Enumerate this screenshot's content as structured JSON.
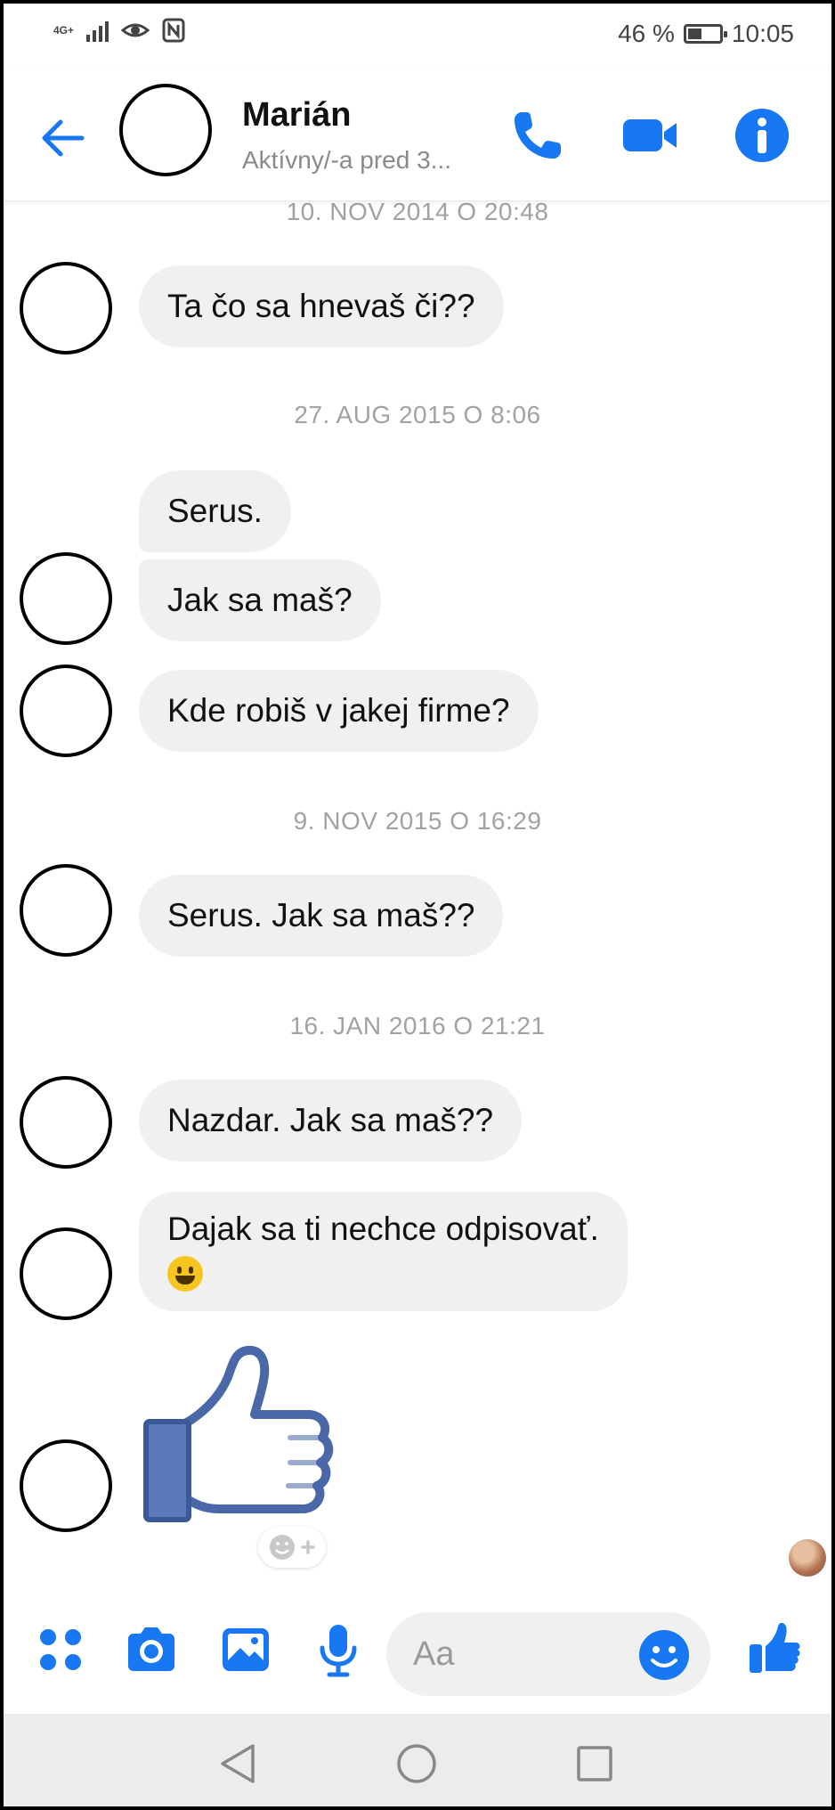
{
  "status_bar": {
    "network": "4G+",
    "battery": "46 %",
    "battery_level": 0.46,
    "time": "10:05"
  },
  "header": {
    "name": "Marián",
    "status": "Aktívny/-a pred 3..."
  },
  "colors": {
    "accent": "#1877f2",
    "bubble": "#f0f0f0",
    "date_text": "#a2a2a2"
  },
  "messages": [
    {
      "date": "10. NOV 2014 O 20:48",
      "text": "Ta čo sa hnevaš či??"
    },
    {
      "date": "27. AUG 2015 O 8:06",
      "text": "Serus."
    },
    {
      "text": "Jak sa maš?"
    },
    {
      "text": "Kde robiš v jakej firme?"
    },
    {
      "date": "9. NOV 2015 O 16:29",
      "text": "Serus. Jak sa maš??"
    },
    {
      "date": "16. JAN 2016 O 21:21",
      "text": "Nazdar. Jak sa maš??"
    },
    {
      "text": "Dajak sa ti nechce odpisovať.",
      "emoji": "grinning-face-emoji"
    },
    {
      "sticker": "thumbs-up-sticker"
    }
  ],
  "composer": {
    "placeholder": "Aa",
    "icons": [
      "menu-grid-icon",
      "camera-icon",
      "gallery-icon",
      "microphone-icon",
      "emoji-icon",
      "like-icon"
    ]
  },
  "navbar": {
    "icons": [
      "back-triangle-icon",
      "home-circle-icon",
      "recents-square-icon"
    ]
  }
}
